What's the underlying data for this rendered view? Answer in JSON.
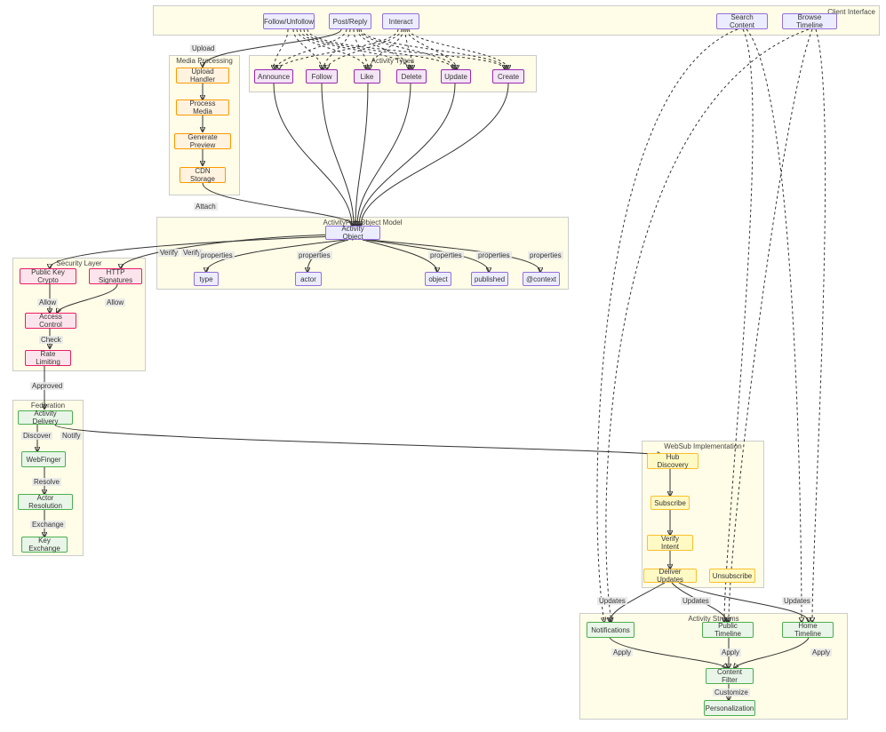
{
  "groups": {
    "client": {
      "label": "Client Interface"
    },
    "types": {
      "label": "Activity Types"
    },
    "media": {
      "label": "Media Processing"
    },
    "apmodel": {
      "label": "ActivityPub Object Model"
    },
    "security": {
      "label": "Security Layer"
    },
    "federation": {
      "label": "Federation"
    },
    "websub": {
      "label": "WebSub Implementation"
    },
    "streams": {
      "label": "Activity Streams"
    }
  },
  "nodes": {
    "followUnfollow": "Follow/Unfollow",
    "postReply": "Post/Reply",
    "interact": "Interact",
    "searchContent": "Search Content",
    "browseTimeline": "Browse Timeline",
    "announce": "Announce",
    "follow": "Follow",
    "like": "Like",
    "delete": "Delete",
    "update": "Update",
    "create": "Create",
    "uploadHandler": "Upload Handler",
    "processMedia": "Process Media",
    "generatePreview": "Generate Preview",
    "cdnStorage": "CDN Storage",
    "activityObject": "Activity Object",
    "type": "type",
    "actor": "actor",
    "object": "object",
    "published": "published",
    "context": "@context",
    "publicKeyCrypto": "Public Key Crypto",
    "httpSignatures": "HTTP Signatures",
    "accessControl": "Access Control",
    "rateLimiting": "Rate Limiting",
    "activityDelivery": "Activity Delivery",
    "webfinger": "WebFinger",
    "actorResolution": "Actor Resolution",
    "keyExchange": "Key Exchange",
    "hubDiscovery": "Hub Discovery",
    "subscribe": "Subscribe",
    "verifyIntent": "Verify Intent",
    "deliverUpdates": "Deliver Updates",
    "unsubscribe": "Unsubscribe",
    "notifications": "Notifications",
    "publicTimeline": "Public Timeline",
    "homeTimeline": "Home Timeline",
    "contentFilter": "Content Filter",
    "personalization": "Personalization"
  },
  "edgeLabels": {
    "upload": "Upload",
    "attach": "Attach",
    "verify1": "Verify",
    "verify2": "Verify",
    "properties1": "properties",
    "properties2": "properties",
    "properties3": "properties",
    "properties4": "properties",
    "properties5": "properties",
    "allow1": "Allow",
    "allow2": "Allow",
    "check": "Check",
    "approved": "Approved",
    "discover": "Discover",
    "notify": "Notify",
    "resolve": "Resolve",
    "exchange": "Exchange",
    "updates1": "Updates",
    "updates2": "Updates",
    "updates3": "Updates",
    "apply1": "Apply",
    "apply2": "Apply",
    "apply3": "Apply",
    "customize": "Customize"
  }
}
